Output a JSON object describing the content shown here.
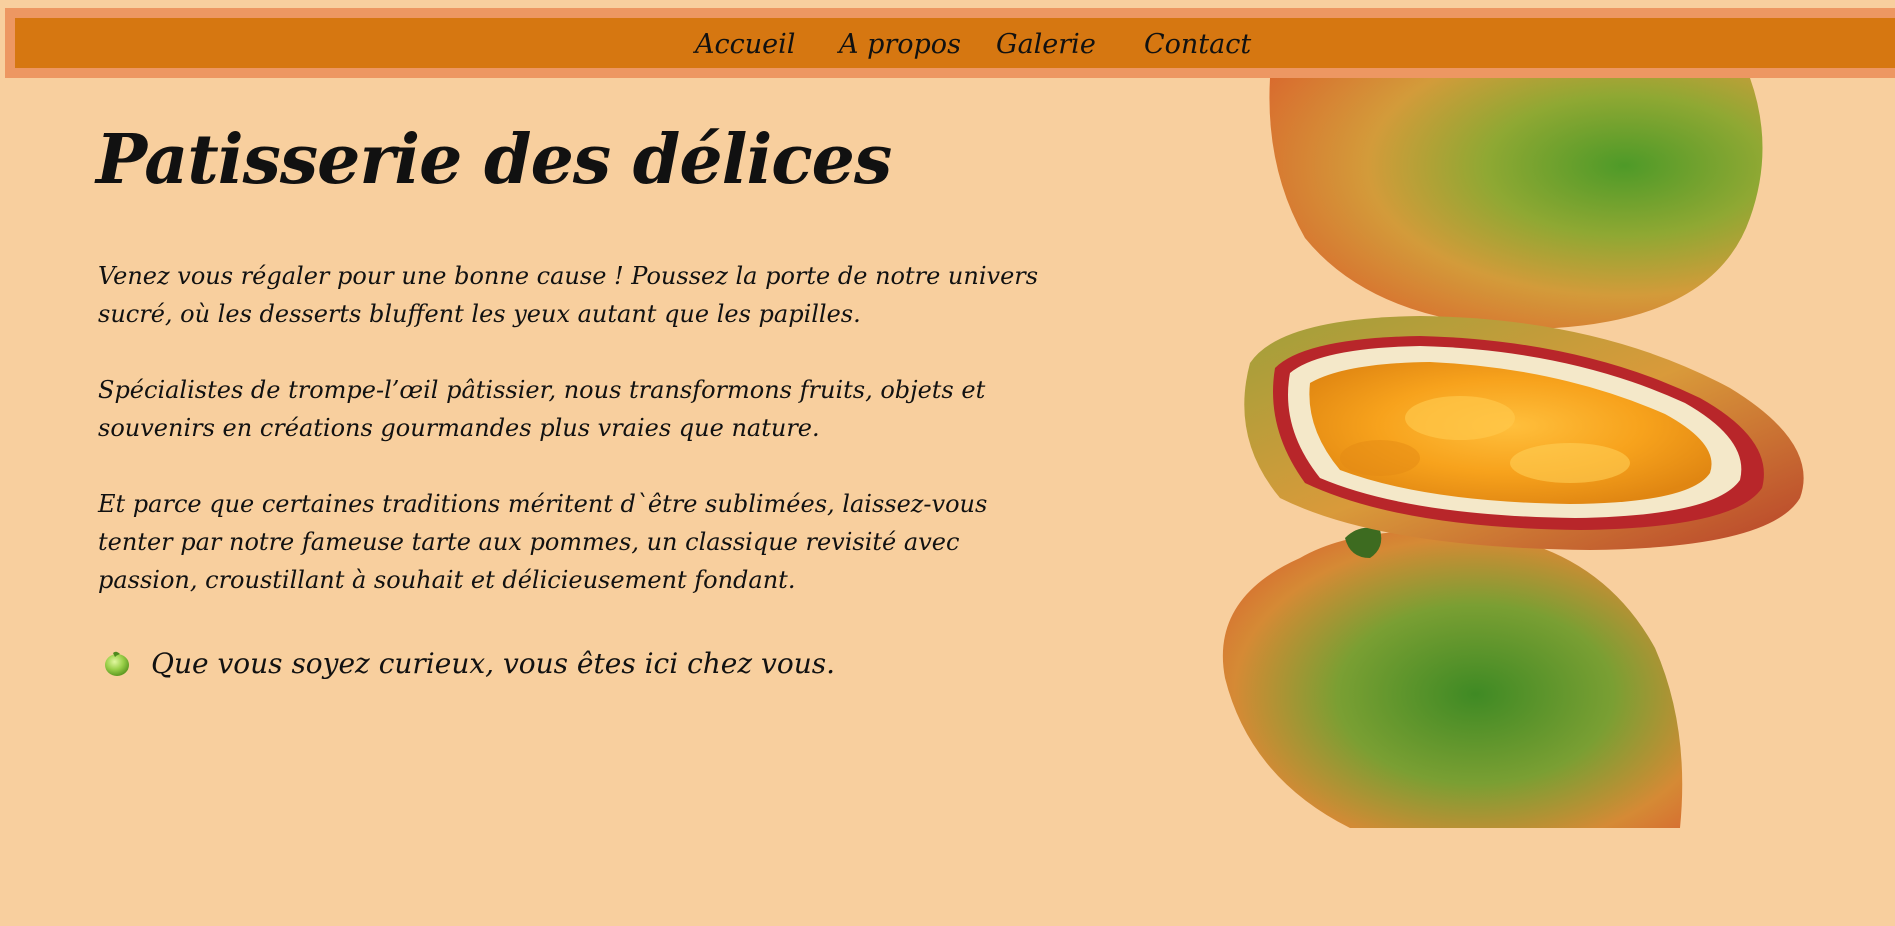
{
  "nav": {
    "items": [
      {
        "label": "Accueil"
      },
      {
        "label": "A propos"
      },
      {
        "label": "Galerie"
      },
      {
        "label": "Contact"
      }
    ]
  },
  "main": {
    "title": "Patisserie des délices",
    "paragraphs": [
      "Venez vous régaler pour une bonne cause ! Poussez la porte de notre univers sucré, où les desserts bluffent les yeux autant que les papilles.",
      "Spécialistes de trompe-l’œil pâtissier, nous transformons fruits, objets et souvenirs en créations gourmandes plus vraies que nature.",
      "Et parce que certaines traditions méritent d`être sublimées, laissez-vous tenter par notre fameuse tarte aux pommes, un classique revisité avec passion, croustillant à souhait et délicieusement fondant."
    ],
    "closing": "Que vous soyez curieux, vous êtes ici chez vous.",
    "closing_icon": "lime-icon"
  },
  "colors": {
    "background": "#f8cf9e",
    "nav_outer": "#ed9762",
    "nav_inner": "#d67711"
  },
  "hero_image": {
    "icon": "mango-stack-image"
  }
}
